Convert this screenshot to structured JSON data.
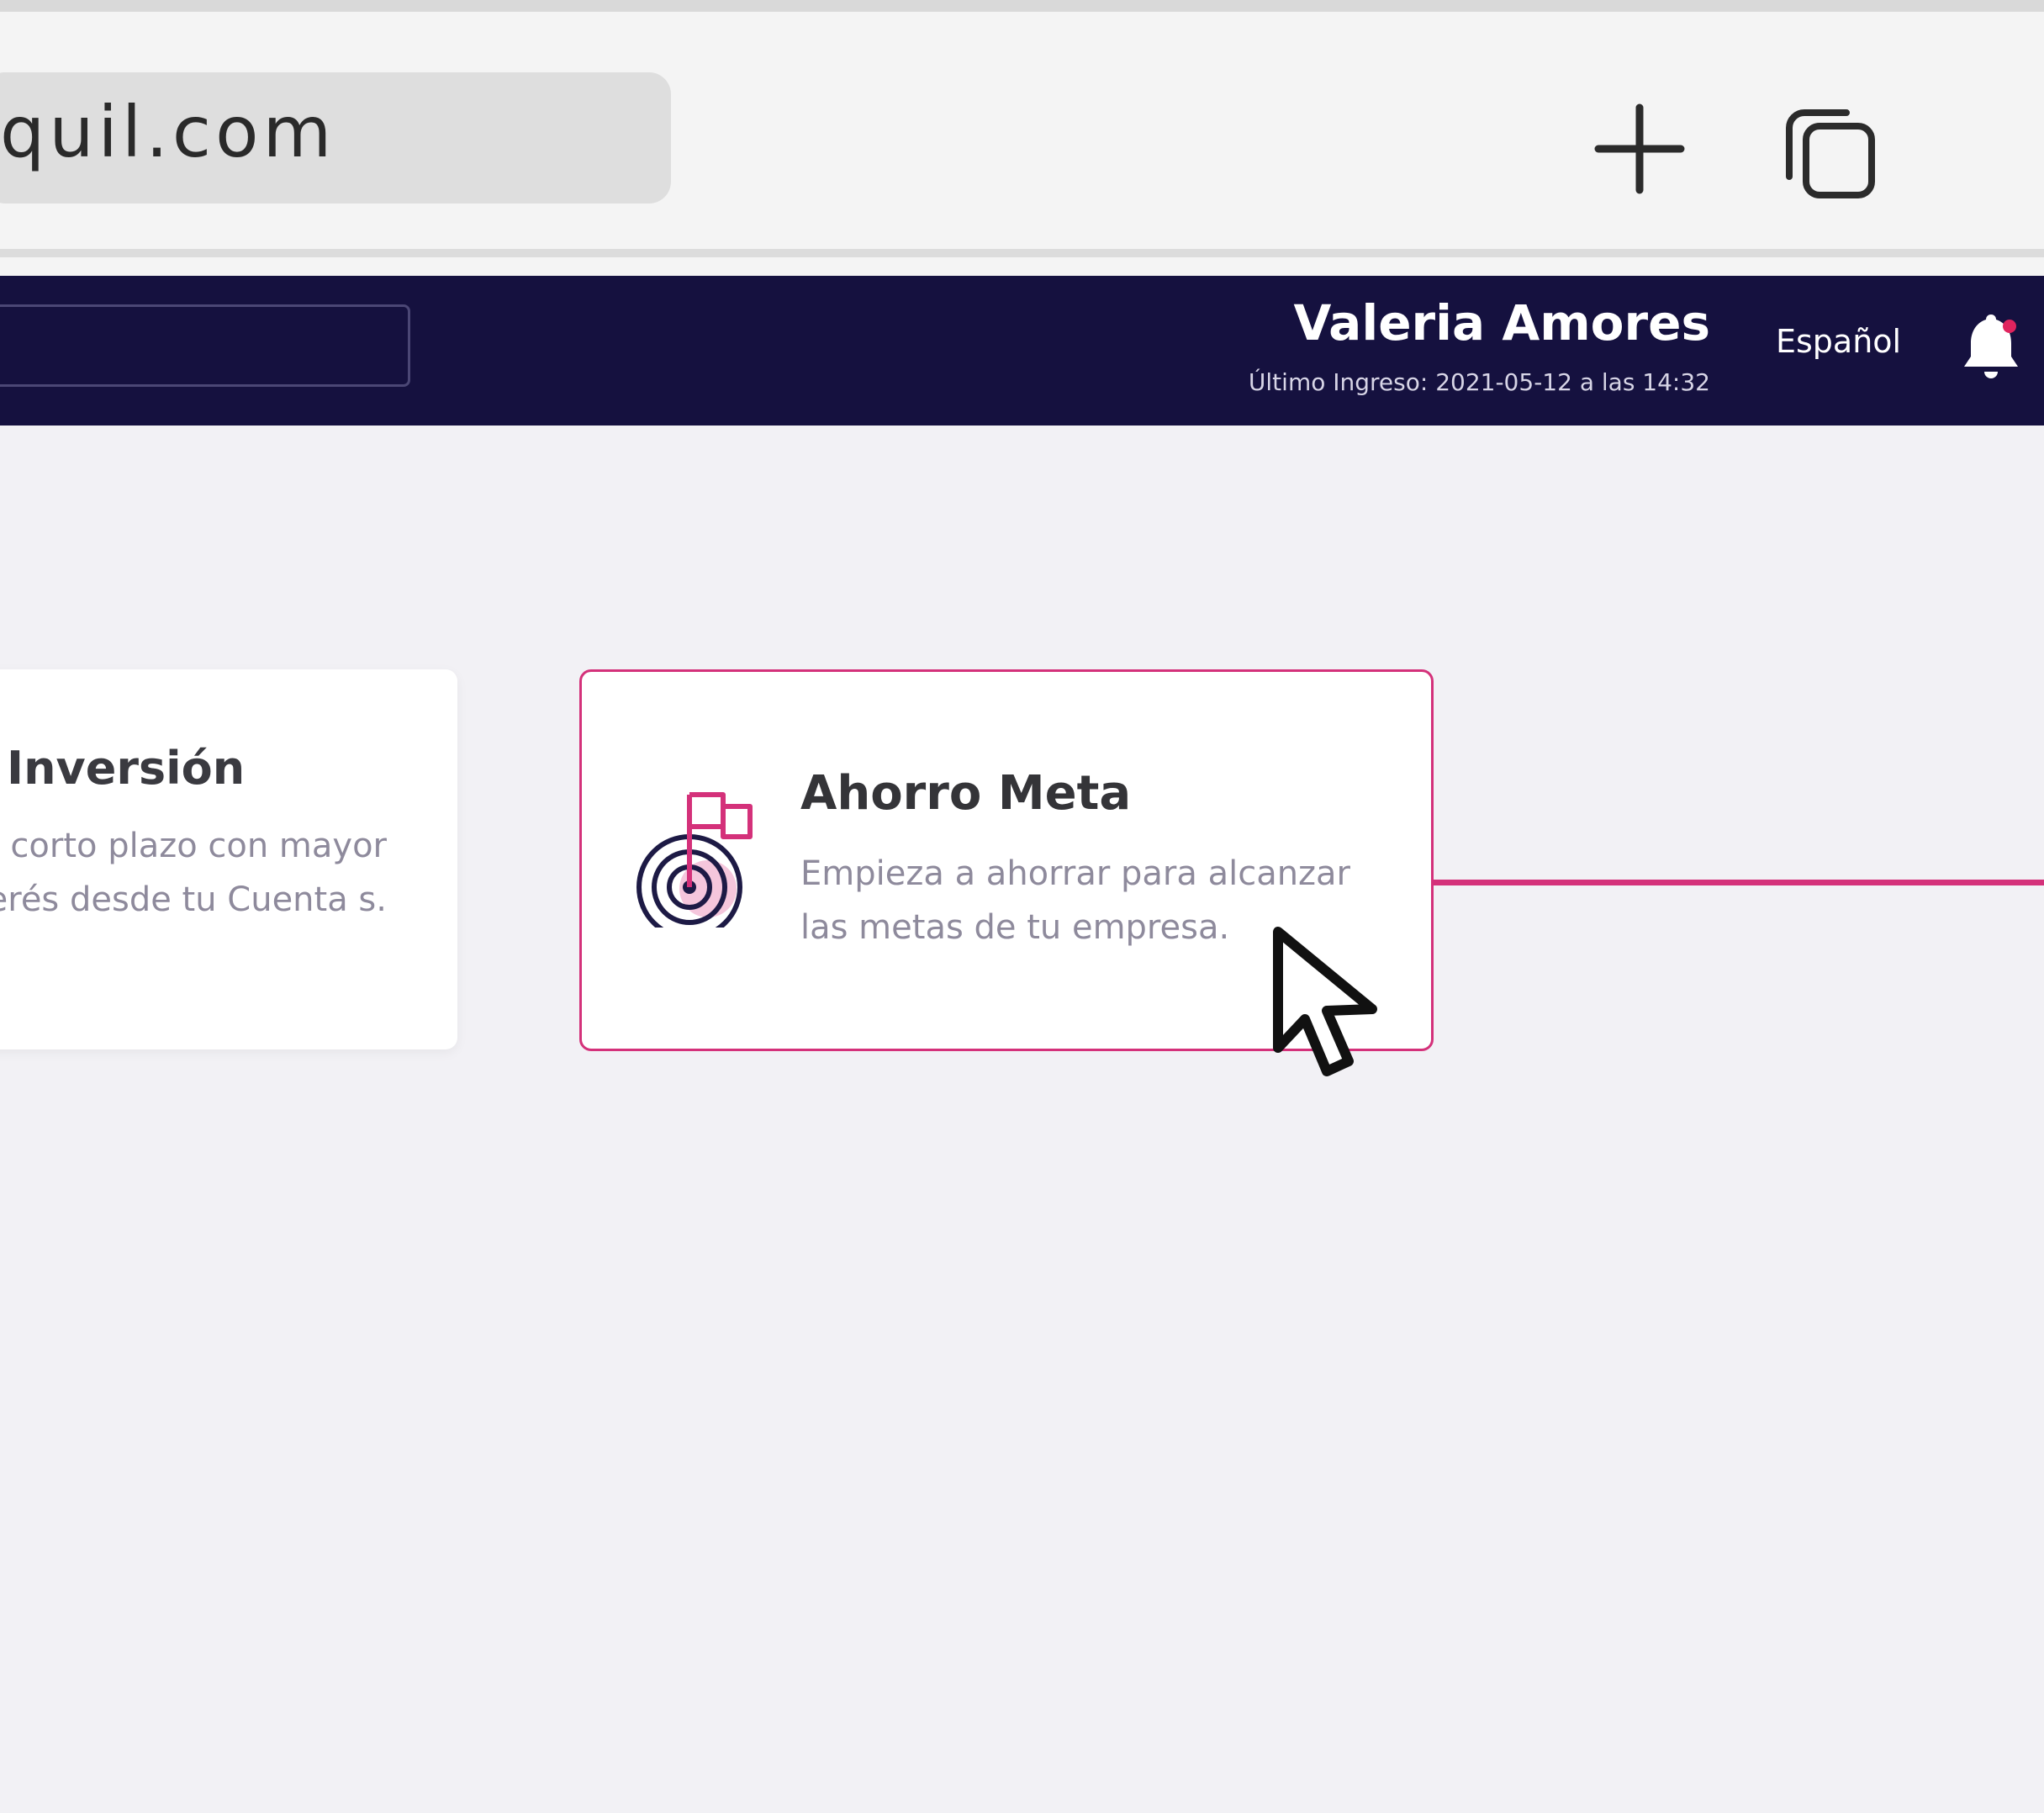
{
  "browser": {
    "url": "quil.com",
    "new_tab_icon": "plus-icon",
    "tabs_icon": "tabs-icon"
  },
  "header": {
    "user_name": "Valeria Amores",
    "last_login": "Último Ingreso: 2021-05-12 a las 14:32",
    "language": "Español",
    "notification_icon": "bell-icon"
  },
  "cards": [
    {
      "title": "Inversión",
      "description": "corto plazo con mayor terés desde tu Cuenta s."
    },
    {
      "title": "Ahorro Meta",
      "description": "Empieza a ahorrar para alcanzar las metas de tu empresa.",
      "icon": "target-flag-icon"
    }
  ],
  "colors": {
    "header_bg": "#15113f",
    "accent": "#d4317a",
    "page_bg": "#f2f1f5"
  }
}
